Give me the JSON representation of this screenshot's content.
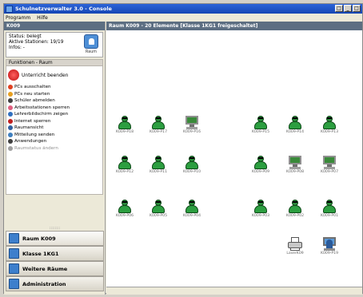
{
  "window": {
    "title": "Schulnetzverwalter 3.0 - Console",
    "buttons": [
      "□",
      "_",
      "□"
    ]
  },
  "menu": [
    "Programm",
    "Hilfe"
  ],
  "left": {
    "header": "K009",
    "status": {
      "line1": "Status: belegt",
      "line2": "Aktive Stationen: 19/19",
      "line3": "Infos: -",
      "icon_label": "Raum"
    },
    "functions_header": "Funktionen - Raum",
    "primary_action": "Unterricht beenden",
    "functions": [
      {
        "label": "PCs ausschalten",
        "color": "#e04020",
        "disabled": false
      },
      {
        "label": "PCs neu starten",
        "color": "#e8a020",
        "disabled": false
      },
      {
        "label": "Schüler abmelden",
        "color": "#404040",
        "disabled": false
      },
      {
        "label": "Arbeitsstationen sperren",
        "color": "#e06080",
        "disabled": false
      },
      {
        "label": "Lehrerbildschirm zeigen",
        "color": "#3070c0",
        "disabled": false
      },
      {
        "label": "Internet sperren",
        "color": "#c02020",
        "disabled": false
      },
      {
        "label": "Raumansicht",
        "color": "#3060a0",
        "disabled": false
      },
      {
        "label": "Mitteilung senden",
        "color": "#4080c0",
        "disabled": false
      },
      {
        "label": "Anwendungen",
        "color": "#404040",
        "disabled": false
      },
      {
        "label": "Raumstatus ändern",
        "color": "#a0a0a0",
        "disabled": true
      }
    ],
    "grip": "::::::::",
    "nav": [
      {
        "label": "Raum K009"
      },
      {
        "label": "Klasse 1KG1"
      },
      {
        "label": "Weitere Räume"
      },
      {
        "label": "Administration"
      }
    ]
  },
  "main": {
    "header": "Raum K009 - 20 Elemente [Klasse 1KG1 freigeschaltet]",
    "stations": [
      {
        "label": "K009-P18",
        "kind": "person"
      },
      {
        "label": "K009-P17",
        "kind": "person"
      },
      {
        "label": "K009-P16",
        "kind": "monitor"
      },
      {
        "label": "K009-P15",
        "kind": "person"
      },
      {
        "label": "K009-P14",
        "kind": "person"
      },
      {
        "label": "K009-P13",
        "kind": "person"
      },
      {
        "label": "K009-P12",
        "kind": "person"
      },
      {
        "label": "K009-P11",
        "kind": "person"
      },
      {
        "label": "K009-P10",
        "kind": "person"
      },
      {
        "label": "K009-P09",
        "kind": "person"
      },
      {
        "label": "K009-P08",
        "kind": "monitor"
      },
      {
        "label": "K009-P07",
        "kind": "monitor"
      },
      {
        "label": "K009-P06",
        "kind": "person"
      },
      {
        "label": "K009-P05",
        "kind": "person"
      },
      {
        "label": "K009-P04",
        "kind": "person"
      },
      {
        "label": "K009-P03",
        "kind": "person"
      },
      {
        "label": "K009-P02",
        "kind": "person"
      },
      {
        "label": "K009-P01",
        "kind": "person"
      },
      {
        "label": "LaserK09",
        "kind": "printer"
      },
      {
        "label": "K009-P19",
        "kind": "teacher"
      }
    ]
  }
}
